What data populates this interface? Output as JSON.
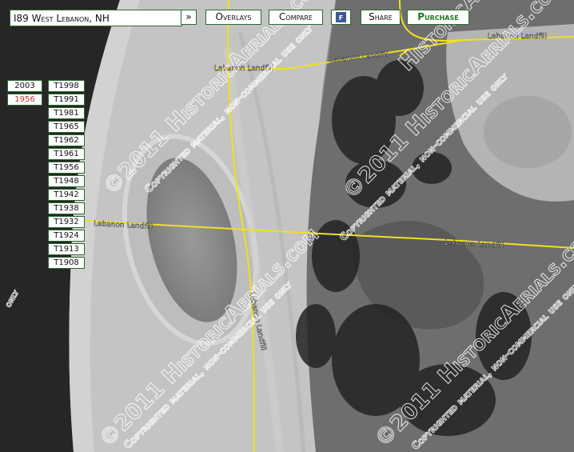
{
  "toolbar": {
    "search_value": "I89 West Lebanon, NH",
    "go_label": "»",
    "overlays_label": "Overlays",
    "compare_label": "Compare",
    "facebook_glyph": "f",
    "share_label": "Share",
    "purchase_label": "Purchase"
  },
  "years_photo": [
    "2003",
    "1956"
  ],
  "active_year": "1956",
  "years_topo": [
    "T1998",
    "T1991",
    "T1981",
    "T1965",
    "T1962",
    "T1961",
    "T1956",
    "T1948",
    "T1942",
    "T1938",
    "T1932",
    "T1924",
    "T1913",
    "T1908"
  ],
  "map": {
    "road_labels": [
      "Lebanon Landfill",
      "Lebanon Landfill",
      "Lebanon Landfill",
      "Lebanon Landfill",
      "Lebanon Landfill"
    ],
    "watermark_site": "HistoricAerials.com",
    "watermark_copyright": "©2011 HistoricAerials.com",
    "watermark_notice": "Copyrighted material, non-commercial use only",
    "watermark_fragment": "only",
    "road_color": "#f0e020"
  }
}
